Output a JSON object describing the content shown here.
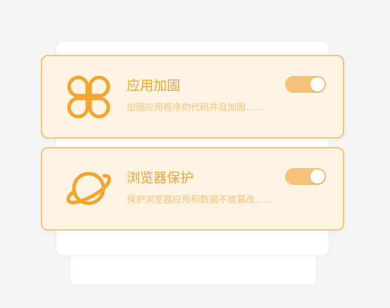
{
  "colors": {
    "accent": "#f3a52d",
    "accent_light": "#f7c47a",
    "card_bg": "#fff3e4",
    "card_border": "#f6c57a",
    "toggle_on": "#f6c27a"
  },
  "features": [
    {
      "title": "应用加固",
      "description": "加固应用程序的代码并且加固……",
      "icon": "clover-icon",
      "enabled": true
    },
    {
      "title": "浏览器保护",
      "description": "保护浏览器应用和数据不被篡改……",
      "icon": "planet-icon",
      "enabled": true
    }
  ]
}
